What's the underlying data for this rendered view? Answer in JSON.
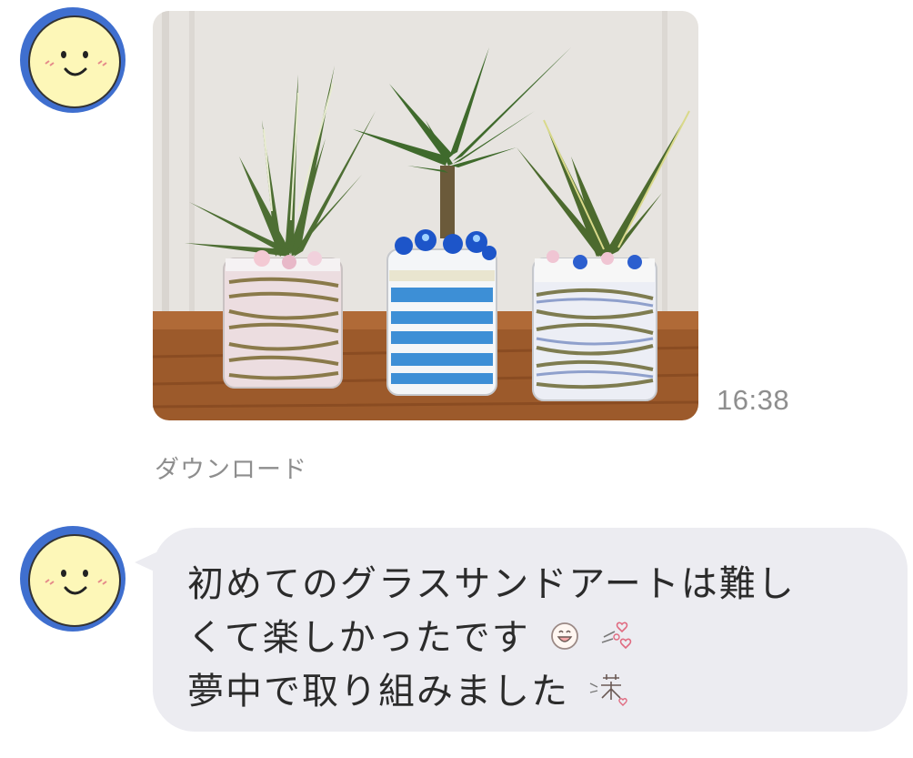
{
  "chat": {
    "messages": [
      {
        "type": "image",
        "image_alt": "Three potted plants in glass cups with layered sand art",
        "time": "16:38",
        "download_label": "ダウンロード"
      },
      {
        "type": "text",
        "lines": [
          "初めてのグラスサンドアートは難し",
          "くて楽しかったです",
          "夢中で取り組みました"
        ],
        "emoji": [
          "smiley-face",
          "floating-hearts",
          "laugh-kanji"
        ]
      }
    ]
  },
  "colors": {
    "avatar_ring": "#3f6fcf",
    "avatar_face": "#fdf7b8",
    "bubble_bg": "#ececf1",
    "meta_text": "#8e8e8e",
    "message_text": "#2b2b2b"
  }
}
